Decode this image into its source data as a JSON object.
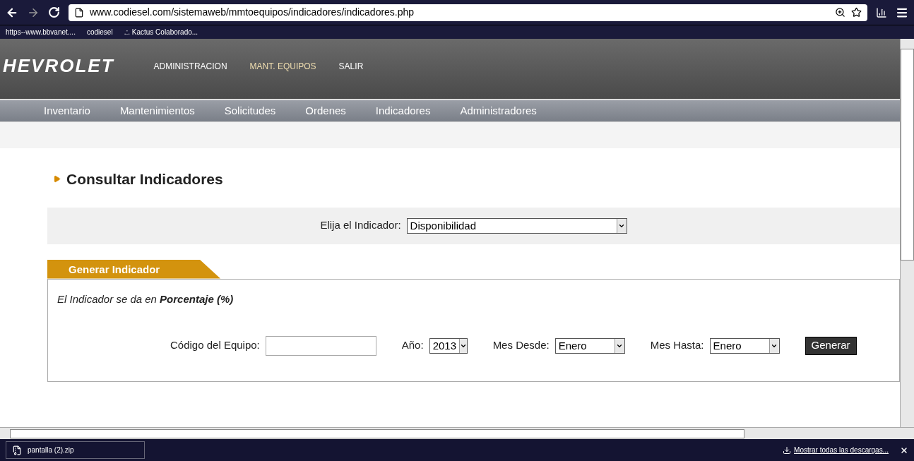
{
  "browser": {
    "url": "www.codiesel.com/sistemaweb/mmtoequipos/indicadores/indicadores.php",
    "bookmarks": [
      "https--www.bbvanet....",
      "codiesel",
      ".:. Kactus Colaborado..."
    ]
  },
  "header": {
    "logo": "HEVROLET",
    "links": [
      {
        "label": "ADMINISTRACION",
        "selected": false
      },
      {
        "label": "MANT. EQUIPOS",
        "selected": true
      },
      {
        "label": "SALIR",
        "selected": false
      }
    ]
  },
  "nav": [
    "Inventario",
    "Mantenimientos",
    "Solicitudes",
    "Ordenes",
    "Indicadores",
    "Administradores"
  ],
  "page_title": "Consultar Indicadores",
  "indicator": {
    "label": "Elija el Indicador:",
    "value": "Disponibilidad"
  },
  "panel": {
    "tab": "Generar Indicador",
    "note": "El Indicador se da en **Porcentaje (%)**",
    "fields": [
      {
        "kind": "text",
        "label": "Código del Equipo:"
      },
      {
        "kind": "select",
        "label": "Año:",
        "value": "2013"
      },
      {
        "kind": "select",
        "label": "Mes Desde:",
        "value": "Enero"
      },
      {
        "kind": "select",
        "label": "Mes Hasta:",
        "value": "Enero"
      }
    ],
    "button": "Generar"
  },
  "downloads": {
    "file": "pantalla (2).zip",
    "show_all": "Mostrar todas las descargas..."
  }
}
